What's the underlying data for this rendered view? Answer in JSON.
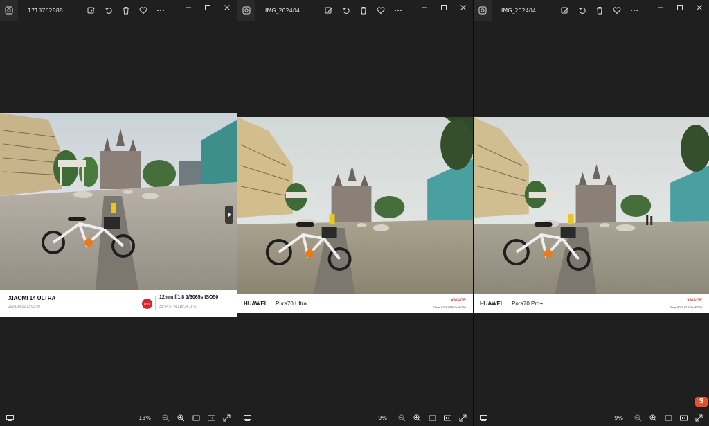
{
  "windows": [
    {
      "filename": "1713762888...",
      "zoom": "13%",
      "watermark": {
        "model": "XIAOMI 14 ULTRA",
        "datetime": "2024.04.22  13:00:59",
        "exif": "12mm  f/1.8  1/3065s  ISO50",
        "gps": "39°54'57\"N  116°24'18\"E",
        "logo": "Leica"
      }
    },
    {
      "filename": "IMG_202404...",
      "zoom": "9%",
      "watermark": {
        "brand": "HUAWEI",
        "model": "Pura70 Ultra",
        "tag": "XMAGE",
        "exif": "13mm  F2.2  1/1562s  ISO50"
      }
    },
    {
      "filename": "IMG_202404...",
      "zoom": "9%",
      "watermark": {
        "brand": "HUAWEI",
        "model": "Pura70 Pro+",
        "tag": "XMAGE",
        "exif": "13mm  F2.2  1/1235s  ISO50"
      }
    }
  ],
  "icons": {
    "app": "photos-app-icon",
    "edit": "edit-image-icon",
    "rotate": "rotate-icon",
    "delete": "trash-icon",
    "favorite": "heart-icon",
    "more": "more-icon",
    "minimize": "minimize-icon",
    "maximize": "maximize-icon",
    "close": "close-icon"
  },
  "corner_badge": "S",
  "colors": {
    "background": "#1f1f1f",
    "leica_red": "#d9262b",
    "xmage_red": "#e03a3a",
    "badge": "#e8502a"
  }
}
